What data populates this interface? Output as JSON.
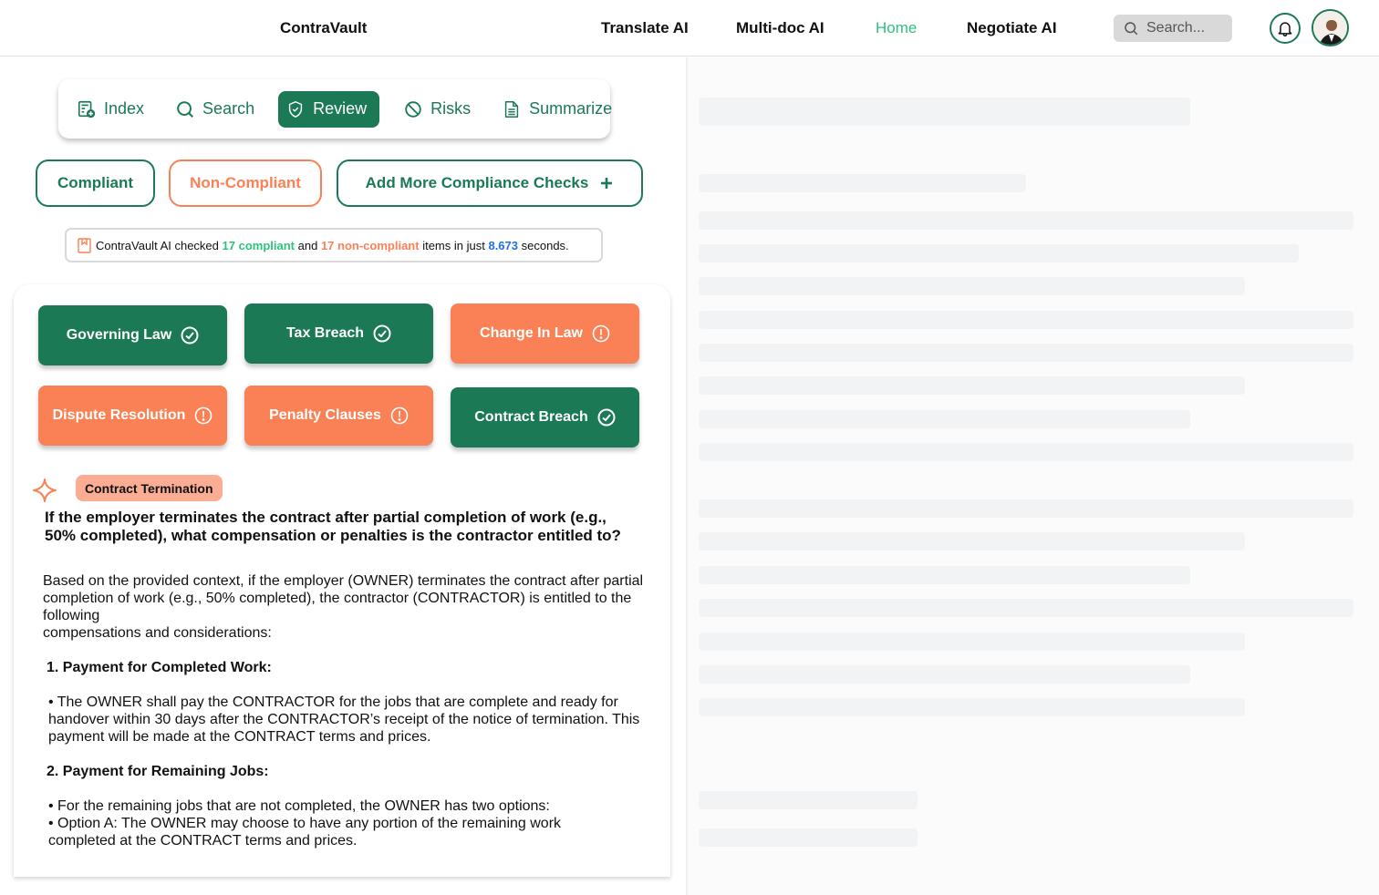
{
  "header": {
    "brand": "ContraVault",
    "nav": [
      {
        "label": "Translate AI",
        "active": false
      },
      {
        "label": "Multi-doc AI",
        "active": false
      },
      {
        "label": "Home",
        "active": true
      },
      {
        "label": "Negotiate AI",
        "active": false
      }
    ],
    "search_placeholder": "Search...",
    "icons": {
      "search": "search-icon",
      "notifications": "bell-icon",
      "avatar": "user-avatar"
    }
  },
  "toolbar": {
    "tools": [
      {
        "label": "Index",
        "icon": "index-add-icon",
        "active": false
      },
      {
        "label": "Search",
        "icon": "search-icon",
        "active": false
      },
      {
        "label": "Review",
        "icon": "shield-check-icon",
        "active": true
      },
      {
        "label": "Risks",
        "icon": "prohibited-icon",
        "active": false
      },
      {
        "label": "Summarize",
        "icon": "document-icon",
        "active": false
      }
    ]
  },
  "filters": {
    "compliant": "Compliant",
    "non_compliant": "Non-Compliant",
    "add_more": "Add More Compliance Checks",
    "add_icon": "plus-icon"
  },
  "status": {
    "prefix": "ContraVault AI checked",
    "compliant_count": "17 compliant",
    "and": "and",
    "non_compliant_count": "17 non-compliant",
    "middle": "items in just",
    "seconds_value": "8.673",
    "suffix": "seconds."
  },
  "checks": [
    {
      "label": "Governing Law",
      "status": "compliant"
    },
    {
      "label": "Tax Breach",
      "status": "compliant"
    },
    {
      "label": "Change In Law",
      "status": "non-compliant"
    },
    {
      "label": "Dispute Resolution",
      "status": "non-compliant"
    },
    {
      "label": "Penalty Clauses",
      "status": "non-compliant"
    },
    {
      "label": "Contract Breach",
      "status": "compliant"
    }
  ],
  "result": {
    "topic": "Contract Termination",
    "question": "If the employer terminates the contract after partial completion of work (e.g., 50% completed), what compensation or penalties is the contractor entitled to?",
    "intro_1": "Based on the provided context, if the employer (OWNER) terminates the contract after partial completion of work (e.g., 50% completed), the contractor (CONTRACTOR) is entitled to the following",
    "intro_2": "compensations and considerations:",
    "section_1_heading": "1. Payment for Completed Work:",
    "section_1_bullet": "• The OWNER shall pay the CONTRACTOR for the jobs that are complete and ready for handover within 30 days after the CONTRACTOR’s receipt of the notice of termination. This payment will be made at the CONTRACT terms and prices.",
    "section_2_heading": "2. Payment for Remaining Jobs:",
    "section_2_bullet_1": "• For the remaining jobs that are not completed, the OWNER has two options:",
    "section_2_bullet_2": "• Option A: The OWNER may choose to have any portion of the remaining work completed at the CONTRACT terms and prices."
  },
  "colors": {
    "brand_green": "#1b7a55",
    "accent_orange": "#fa8155",
    "active_nav": "#2ec27e",
    "highlight_blue": "#1f6fe5",
    "badge_peach": "#fbad93"
  }
}
